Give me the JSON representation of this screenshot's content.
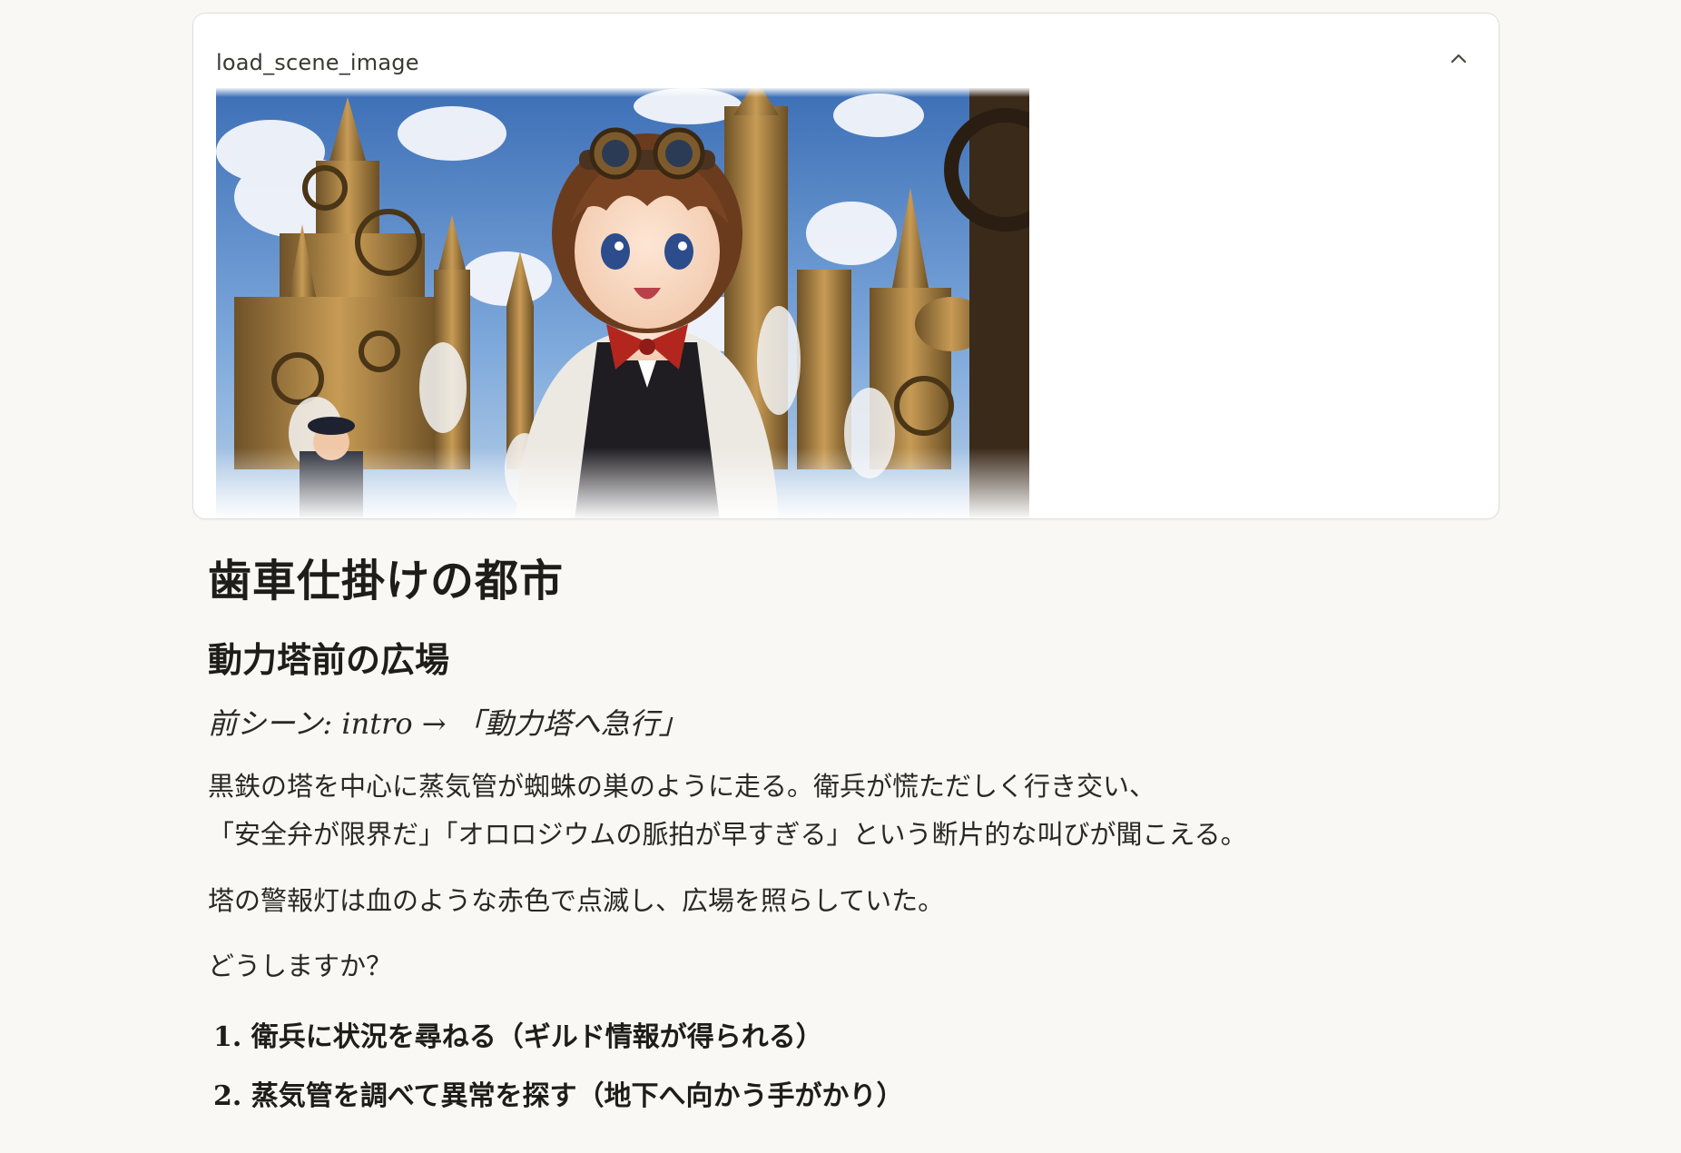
{
  "panel": {
    "title": "load_scene_image",
    "collapse_icon": "chevron-up-icon"
  },
  "scene": {
    "title": "歯車仕掛けの都市",
    "location": "動力塔前の広場",
    "previous": "前シーン: intro → 「動力塔へ急行」",
    "paragraph1_line1": "黒鉄の塔を中心に蒸気管が蜘蛛の巣のように走る。衛兵が慌ただしく行き交い、",
    "paragraph1_line2": "「安全弁が限界だ」「オロロジウムの脈拍が早すぎる」という断片的な叫びが聞こえる。",
    "paragraph2": "塔の警報灯は血のような赤色で点滅し、広場を照らしていた。",
    "prompt": "どうしますか？",
    "choices": [
      "1. 衛兵に状況を尋ねる（ギルド情報が得られる）",
      "2. 蒸気管を調べて異常を探す（地下へ向かう手がかり）"
    ]
  }
}
